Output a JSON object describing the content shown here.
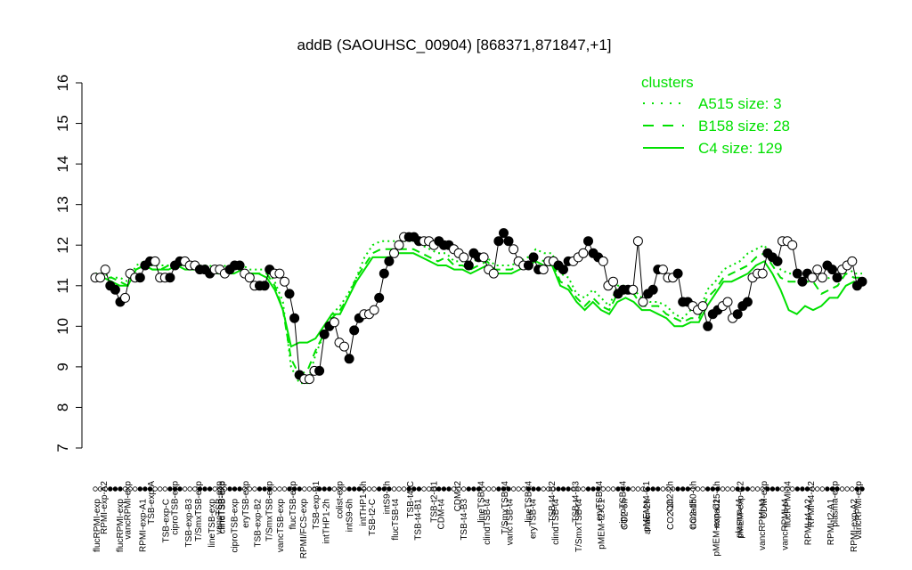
{
  "chart_data": {
    "type": "line",
    "title": "addB (SAOUHSC_00904) [868371,871847,+1]",
    "xlabel": "",
    "ylabel": "",
    "ylim": [
      7,
      16
    ],
    "yticks": [
      7,
      8,
      9,
      10,
      11,
      12,
      13,
      14,
      15,
      16
    ],
    "grid": false,
    "legend": {
      "title": "clusters",
      "placement": "top-right",
      "color": "#00e000",
      "entries": [
        {
          "label": "A515 size: 3",
          "style": "dotted"
        },
        {
          "label": "B158 size: 28",
          "style": "dashed"
        },
        {
          "label": "C4 size: 129",
          "style": "solid"
        }
      ]
    },
    "tick_labels_top": [
      "RPMI-exp-A2",
      "vancRPMI-exp",
      "TSB-exp-A",
      "ciproTSB-exp",
      "T/SmxTSB-exp",
      "clindTSB-exp",
      "eryTSB-exp",
      "T/SmxTSB-exp",
      "flucTSB-exp",
      "TSB-exp-B1",
      "colist-exp",
      "intTHP1-6h",
      "intS9-2h",
      "TSB-t4-C",
      "TSB-t2-B1",
      "CDM-t2",
      "lineTSB-t4",
      "T/SmxTSB-t4",
      "lineTSB-t4",
      "TSB-t4-B2",
      "TSB-t4-B3",
      "eryTSB-t4",
      "ciproTSB-t4",
      "pMEM-t4-C1",
      "CO2-2h",
      "nonad50-1h",
      "nonad25-1h",
      "pMEM-exp-C2",
      "CDM-exp",
      "flucRPMI-t4",
      "RPMI-t4-A2",
      "plasma-exp",
      "vancRPMI-exp"
    ],
    "tick_labels_overlap": [
      "vancTSB-exp",
      "lineTSB-exp"
    ],
    "tick_labels_bottom": [
      "flucRPMI-exp",
      "flucRPMI-exp",
      "RPMI-exp-A1",
      "TSB-exp-C",
      "TSB-exp-B3",
      "lineTSB-exp",
      "ciproTSB-exp",
      "TSB-exp-B2",
      "vancTSB-exp",
      "RPMI/FCS-exp",
      "intTHP1-2h",
      "intS9-6h",
      "TSB-t2-C",
      "flucTSB-t4",
      "TSB-t4-B1",
      "CDM-t4",
      "TSB-t4-B3",
      "clindTSB-t4",
      "vancTSB-t4",
      "eryTSB-t4",
      "clindTSB-t4",
      "T/SmxTSB-t4",
      "pMEM-t2-C1",
      "CO2-6h",
      "anaer-2h",
      "CO2-1h",
      "CO2-1h",
      "pMEM-exp-C1",
      "plasma-t4",
      "vancRPMI-t4",
      "vancRPMI-t4",
      "RPMI-t4-A2",
      "RPMI-t2-A1",
      "RPMI-exp-A2"
    ],
    "series": [
      {
        "name": "A515 size: 3",
        "style": "dotted",
        "values": [
          11.3,
          11.3,
          11.2,
          11.2,
          11.1,
          11.5,
          11.6,
          11.5,
          11.5,
          11.5,
          11.5,
          11.5,
          11.5,
          11.5,
          11.5,
          11.4,
          11.5,
          11.5,
          11.5,
          11.4,
          11.4,
          11.4,
          11.1,
          10.6,
          9.0,
          8.6,
          8.6,
          9.3,
          9.8,
          10.3,
          10.5,
          10.8,
          11.2,
          11.7,
          12.0,
          12.1,
          12.1,
          12.1,
          12.1,
          12.1,
          12.0,
          11.9,
          11.8,
          11.8,
          11.6,
          11.6,
          11.5,
          11.7,
          11.7,
          11.5,
          11.5,
          11.5,
          11.6,
          11.7,
          11.9,
          11.8,
          11.8,
          11.3,
          11.2,
          10.8,
          10.7,
          10.9,
          10.7,
          10.5,
          11.0,
          11.0,
          10.9,
          10.7,
          10.6,
          10.6,
          10.5,
          10.3,
          10.2,
          10.4,
          10.3,
          10.9,
          11.1,
          11.4,
          11.5,
          11.6,
          11.8,
          11.9,
          12.0,
          11.7,
          11.4,
          11.3,
          11.3,
          11.3,
          11.3,
          11.1,
          11.2,
          11.2,
          11.5,
          11.3,
          11.3
        ]
      },
      {
        "name": "B158 size: 28",
        "style": "dashed",
        "values": [
          11.2,
          11.2,
          11.2,
          11.1,
          11.0,
          11.4,
          11.5,
          11.4,
          11.4,
          11.5,
          11.5,
          11.5,
          11.5,
          11.4,
          11.4,
          11.4,
          11.4,
          11.4,
          11.4,
          11.3,
          11.3,
          11.3,
          11.0,
          10.4,
          9.2,
          8.8,
          8.9,
          9.4,
          9.8,
          10.2,
          10.4,
          10.7,
          11.2,
          11.5,
          11.8,
          11.9,
          11.9,
          11.9,
          11.9,
          11.9,
          11.8,
          11.7,
          11.6,
          11.7,
          11.5,
          11.5,
          11.4,
          11.5,
          11.6,
          11.4,
          11.4,
          11.4,
          11.5,
          11.6,
          11.7,
          11.6,
          11.6,
          11.1,
          11.0,
          10.7,
          10.5,
          10.7,
          10.5,
          10.4,
          10.8,
          10.9,
          10.8,
          10.5,
          10.5,
          10.5,
          10.3,
          10.2,
          10.1,
          10.2,
          10.2,
          10.7,
          10.9,
          11.2,
          11.3,
          11.4,
          11.5,
          11.7,
          11.8,
          11.5,
          11.2,
          11.1,
          11.1,
          11.1,
          11.1,
          10.8,
          10.9,
          11.0,
          11.3,
          11.2,
          11.2
        ]
      },
      {
        "name": "C4 size: 129",
        "style": "solid",
        "values": [
          11.2,
          11.2,
          11.1,
          11.0,
          11.0,
          11.4,
          11.5,
          11.4,
          11.4,
          11.4,
          11.5,
          11.4,
          11.4,
          11.4,
          11.4,
          11.3,
          11.3,
          11.3,
          11.4,
          11.3,
          11.3,
          11.2,
          10.9,
          10.4,
          9.5,
          9.6,
          9.6,
          9.7,
          10.0,
          10.3,
          10.3,
          10.7,
          11.1,
          11.4,
          11.7,
          11.7,
          11.7,
          11.8,
          11.8,
          11.8,
          11.7,
          11.6,
          11.5,
          11.5,
          11.4,
          11.4,
          11.3,
          11.4,
          11.5,
          11.3,
          11.3,
          11.3,
          11.4,
          11.5,
          11.6,
          11.5,
          11.5,
          11.0,
          10.9,
          10.6,
          10.4,
          10.6,
          10.4,
          10.3,
          10.6,
          10.7,
          10.6,
          10.4,
          10.4,
          10.3,
          10.2,
          10.0,
          10.0,
          10.1,
          10.1,
          10.5,
          10.8,
          11.1,
          11.1,
          11.2,
          11.3,
          11.5,
          11.6,
          11.3,
          10.9,
          10.4,
          10.3,
          10.5,
          10.4,
          10.5,
          10.7,
          10.7,
          11.0,
          11.1,
          11.0
        ]
      }
    ],
    "points": [
      11.2,
      11.2,
      11.4,
      11.0,
      10.9,
      10.6,
      10.7,
      11.3,
      11.2,
      11.2,
      11.5,
      11.6,
      11.6,
      11.2,
      11.2,
      11.2,
      11.5,
      11.6,
      11.6,
      11.5,
      11.5,
      11.4,
      11.4,
      11.3,
      11.4,
      11.4,
      11.3,
      11.4,
      11.5,
      11.5,
      11.3,
      11.2,
      11.0,
      11.0,
      11.0,
      11.4,
      11.3,
      11.3,
      11.1,
      10.8,
      10.2,
      8.8,
      8.7,
      8.7,
      8.9,
      8.9,
      9.8,
      10.0,
      10.1,
      9.6,
      9.5,
      9.2,
      9.9,
      10.2,
      10.3,
      10.3,
      10.4,
      10.7,
      11.3,
      11.6,
      11.8,
      12.0,
      12.2,
      12.2,
      12.2,
      12.1,
      12.1,
      12.1,
      12.0,
      12.1,
      12.0,
      12.0,
      11.9,
      11.8,
      11.7,
      11.5,
      11.8,
      11.7,
      11.7,
      11.4,
      11.3,
      12.1,
      12.3,
      12.1,
      11.9,
      11.6,
      11.5,
      11.5,
      11.7,
      11.4,
      11.4,
      11.6,
      11.6,
      11.5,
      11.4,
      11.6,
      11.6,
      11.7,
      11.8,
      12.1,
      11.8,
      11.7,
      11.6,
      11.0,
      11.1,
      10.8,
      10.9,
      10.9,
      10.9,
      12.1,
      10.6,
      10.8,
      10.9,
      11.4,
      11.4,
      11.2,
      11.2,
      11.3,
      10.6,
      10.6,
      10.5,
      10.4,
      10.5,
      10.0,
      10.3,
      10.4,
      10.5,
      10.6,
      10.2,
      10.3,
      10.5,
      10.6,
      11.2,
      11.3,
      11.3,
      11.8,
      11.7,
      11.6,
      12.1,
      12.1,
      12.0,
      11.3,
      11.1,
      11.3,
      11.2,
      11.4,
      11.2,
      11.5,
      11.4,
      11.2,
      11.4,
      11.5,
      11.6,
      11.0,
      11.1
    ]
  }
}
